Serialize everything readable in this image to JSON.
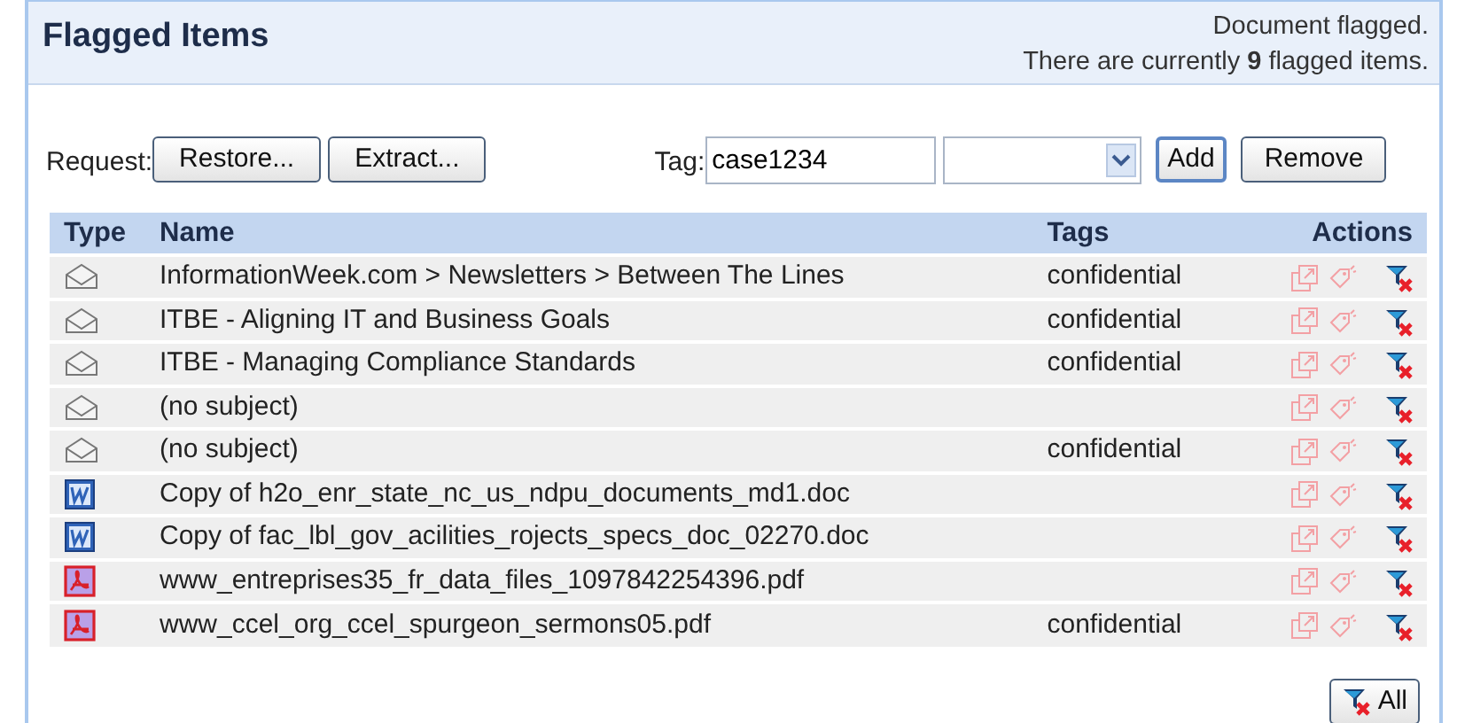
{
  "panel": {
    "title": "Flagged Items",
    "messages": [
      "Document flagged.",
      "There are currently **9** flagged items."
    ]
  },
  "toolbar": {
    "request_label": "Request:",
    "request_buttons": [
      "Restore...",
      "Extract..."
    ],
    "tag_label": "Tag:",
    "tag_value": "case1234",
    "tag_buttons": [
      {
        "label": "Add",
        "focused": true
      },
      {
        "label": "Remove",
        "focused": false
      }
    ]
  },
  "table": {
    "columns": [
      "Type",
      "Name",
      "Tags",
      "Actions"
    ],
    "rows": [
      {
        "kind": "mail",
        "name": "InformationWeek.com > Newsletters > Between The Lines",
        "tags": "confidential",
        "restore_disabled": true,
        "tag_disabled": true
      },
      {
        "kind": "mail",
        "name": "ITBE - Aligning IT and Business Goals",
        "tags": "confidential",
        "restore_disabled": true,
        "tag_disabled": true
      },
      {
        "kind": "mail",
        "name": "ITBE - Managing Compliance Standards",
        "tags": "confidential",
        "restore_disabled": true,
        "tag_disabled": true
      },
      {
        "kind": "mail",
        "name": "(no subject)",
        "restore_disabled": true,
        "tag_disabled": true
      },
      {
        "kind": "mail",
        "name": "(no subject)",
        "tags": "confidential",
        "restore_disabled": true,
        "tag_disabled": true
      },
      {
        "kind": "word",
        "name": "Copy of h2o_enr_state_nc_us_ndpu_documents_md1.doc",
        "restore_disabled": true,
        "tag_disabled": true
      },
      {
        "kind": "word",
        "name": "Copy of fac_lbl_gov_acilities_rojects_specs_doc_02270.doc",
        "restore_disabled": true,
        "tag_disabled": true
      },
      {
        "kind": "pdf",
        "name": "www_entreprises35_fr_data_files_1097842254396.pdf",
        "restore_disabled": true,
        "tag_disabled": true
      },
      {
        "kind": "pdf",
        "name": "www_ccel_org_ccel_spurgeon_sermons05.pdf",
        "tags": "confidential",
        "restore_disabled": true,
        "tag_disabled": true
      }
    ]
  },
  "footer": {
    "unflag_all_label": "All"
  }
}
